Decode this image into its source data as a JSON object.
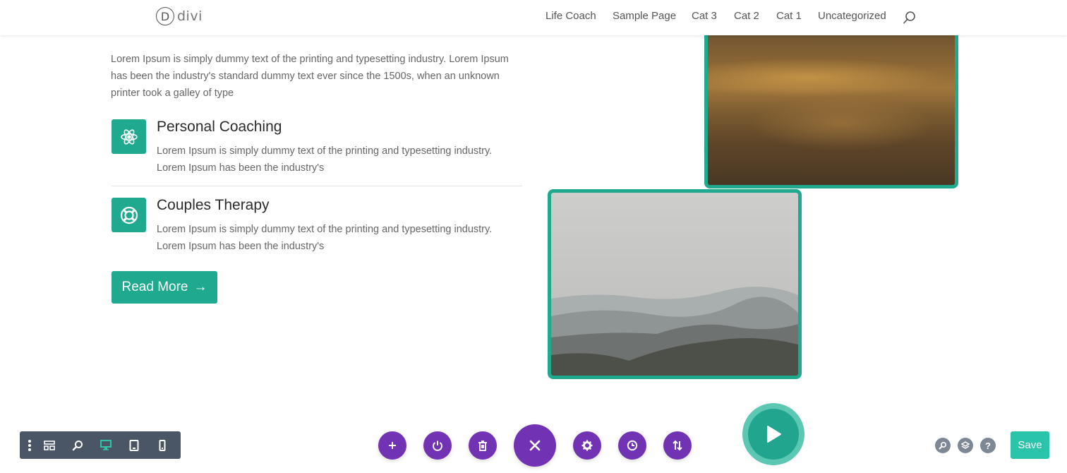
{
  "header": {
    "logo_text": "divi",
    "logo_letter": "D",
    "nav": [
      "Life Coach",
      "Sample Page",
      "Cat 3",
      "Cat 2",
      "Cat 1",
      "Uncategorized"
    ]
  },
  "content": {
    "intro": "Lorem Ipsum is simply dummy text of the printing and typesetting industry. Lorem Ipsum has been the industry's standard dummy text ever since the 1500s, when an unknown printer took a galley of type",
    "features": [
      {
        "title": "Personal Coaching",
        "text": "Lorem Ipsum is simply dummy text of the printing and typesetting industry. Lorem Ipsum has been the industry's",
        "icon": "atom-icon"
      },
      {
        "title": "Couples Therapy",
        "text": "Lorem Ipsum is simply dummy text of the printing and typesetting industry. Lorem Ipsum has been the industry's",
        "icon": "lifebuoy-icon"
      }
    ],
    "read_more": "Read More",
    "read_more_arrow": "→"
  },
  "builder": {
    "left_toolbar_icons": [
      "kebab-menu-icon",
      "wireframe-icon",
      "zoom-icon",
      "desktop-icon",
      "tablet-icon",
      "phone-icon"
    ],
    "center_icons": [
      "add-icon",
      "power-icon",
      "trash-icon",
      "close-icon",
      "settings-icon",
      "history-icon",
      "sort-icon"
    ],
    "right_icons": [
      "search-icon",
      "layers-icon",
      "help-icon"
    ],
    "help_glyph": "?",
    "save_label": "Save"
  },
  "colors": {
    "accent": "#1fa98f",
    "builder_purple": "#7132b3",
    "toolbar_dark": "#4a5565",
    "save_green": "#29c4a9",
    "active_view": "#2ec4a5"
  }
}
